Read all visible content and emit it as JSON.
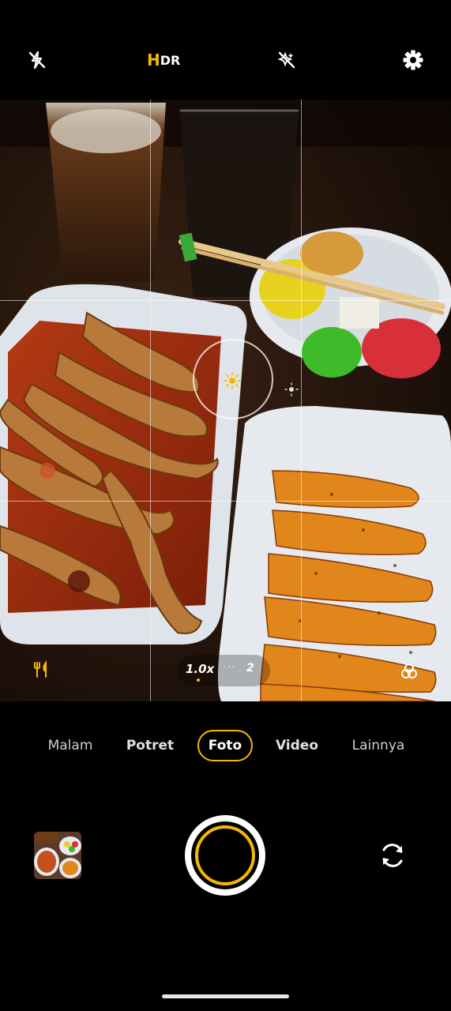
{
  "toolbar": {
    "flash_icon": "flash-off-icon",
    "hdr_h": "H",
    "hdr_dr": "DR",
    "ai_icon": "ai-scene-off-icon",
    "settings_icon": "gear-icon"
  },
  "viewfinder": {
    "zoom_current": "1.0x",
    "zoom_dots": "···",
    "zoom_alt": "2",
    "food_mode_icon": "fork-knife-icon",
    "filter_icon": "filter-circles-icon",
    "exposure_icon": "sun-icon"
  },
  "modes": [
    {
      "label": "Malam",
      "active": false
    },
    {
      "label": "Potret",
      "active": false
    },
    {
      "label": "Foto",
      "active": true
    },
    {
      "label": "Video",
      "active": false
    },
    {
      "label": "Lainnya",
      "active": false
    }
  ],
  "controls": {
    "gallery_icon": "gallery-thumbnail",
    "shutter_icon": "shutter-button",
    "switch_icon": "camera-switch-icon"
  },
  "colors": {
    "accent": "#f5b800",
    "background": "#000000"
  }
}
